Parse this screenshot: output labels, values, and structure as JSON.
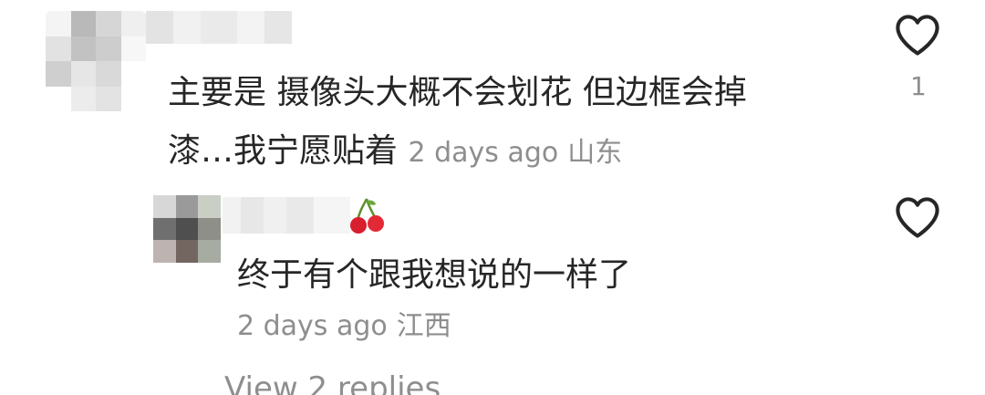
{
  "comments": [
    {
      "text_line1": "主要是 摄像头大概不会划花 但边框会掉",
      "text_line2": "漆…我宁愿贴着",
      "timestamp": "2 days ago",
      "location": "山东",
      "like_count": "1",
      "like_icon": "heart-outline-icon"
    },
    {
      "text": "终于有个跟我想说的一样了",
      "timestamp": "2 days ago",
      "location": "江西",
      "like_icon": "heart-outline-icon",
      "name_emoji": "cherry"
    }
  ],
  "replies": {
    "label": "View 2 replies"
  },
  "colors": {
    "text": "#262626",
    "secondary": "#8e8e8e",
    "background": "#ffffff"
  }
}
